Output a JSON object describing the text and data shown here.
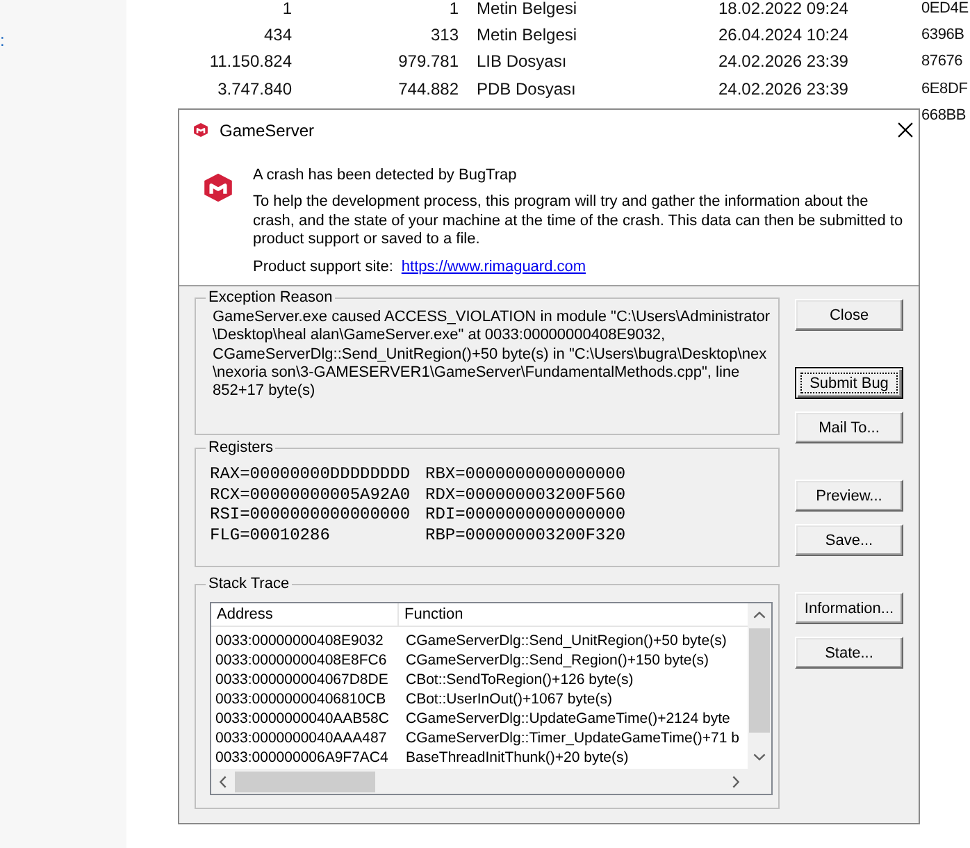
{
  "navigation_pane": {
    "item_fragment": ":"
  },
  "file_list": {
    "rows": [
      {
        "column_1": "1",
        "column_2": "1",
        "column_3": "Metin Belgesi",
        "column_4": "18.02.2022 09:24",
        "column_5": "0ED4E"
      },
      {
        "column_1": "434",
        "column_2": "313",
        "column_3": "Metin Belgesi",
        "column_4": "26.04.2024 10:24",
        "column_5": "6396B"
      },
      {
        "column_1": "11.150.824",
        "column_2": "979.781",
        "column_3": "LIB Dosyası",
        "column_4": "24.02.2026 23:39",
        "column_5": "87676"
      },
      {
        "column_1": "3.747.840",
        "column_2": "744.882",
        "column_3": "PDB Dosyası",
        "column_4": "24.02.2026 23:39",
        "column_5": "6E8DF"
      },
      {
        "column_5": "668BB"
      }
    ]
  },
  "window": {
    "title": "GameServer"
  },
  "header": {
    "heading": "A crash has been detected by BugTrap",
    "description": "To help the development process, this program will try and gather the information about the crash, and the state of your machine at the time of the crash. This data can then be submitted to product support or saved to a file.",
    "support_label": "Product support site:",
    "support_link": "https://www.rimaguard.com"
  },
  "exception_reason": {
    "label": "Exception Reason",
    "text": "GameServer.exe caused ACCESS_VIOLATION in module \"C:\\Users\\Administrator\\Desktop\\heal alan\\GameServer.exe\" at 0033:00000000408E9032, CGameServerDlg::Send_UnitRegion()+50 byte(s) in \"C:\\Users\\bugra\\Desktop\\nex\\nexoria son\\3-GAMESERVER1\\GameServer\\FundamentalMethods.cpp\", line 852+17 byte(s)"
  },
  "registers": {
    "label": "Registers",
    "values": [
      "RAX=00000000DDDDDDDD",
      "RBX=0000000000000000",
      "RCX=00000000005A92A0",
      "RDX=000000003200F560",
      "RSI=0000000000000000",
      "RDI=0000000000000000",
      "FLG=00010286",
      "RBP=000000003200F320"
    ]
  },
  "stack_trace": {
    "label": "Stack Trace",
    "columns": [
      "Address",
      "Function"
    ],
    "rows": [
      {
        "address": "0033:00000000408E9032",
        "function": "CGameServerDlg::Send_UnitRegion()+50 byte(s)"
      },
      {
        "address": "0033:00000000408E8FC6",
        "function": "CGameServerDlg::Send_Region()+150 byte(s)"
      },
      {
        "address": "0033:000000004067D8DE",
        "function": "CBot::SendToRegion()+126 byte(s)"
      },
      {
        "address": "0033:00000000406810CB",
        "function": "CBot::UserInOut()+1067 byte(s)"
      },
      {
        "address": "0033:0000000040AAB58C",
        "function": "CGameServerDlg::UpdateGameTime()+2124 byte"
      },
      {
        "address": "0033:0000000040AAA487",
        "function": "CGameServerDlg::Timer_UpdateGameTime()+71 b"
      },
      {
        "address": "0033:000000006A9F7AC4",
        "function": "BaseThreadInitThunk()+20 byte(s)"
      }
    ]
  },
  "buttons": [
    {
      "label": "Close",
      "focused": false
    },
    {
      "label": "Submit Bug",
      "focused": true
    },
    {
      "label": "Mail To...",
      "focused": false
    },
    {
      "label": "Preview...",
      "focused": false
    },
    {
      "label": "Save...",
      "focused": false
    },
    {
      "label": "Information...",
      "focused": false
    },
    {
      "label": "State...",
      "focused": false
    }
  ]
}
